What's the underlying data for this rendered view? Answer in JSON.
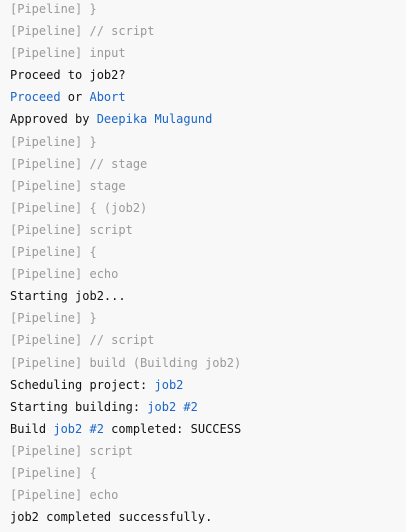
{
  "console": {
    "lines": [
      {
        "kind": "pipeline",
        "text": "[Pipeline] }"
      },
      {
        "kind": "pipeline",
        "text": "[Pipeline] // script"
      },
      {
        "kind": "pipeline",
        "text": "[Pipeline] input"
      },
      {
        "kind": "output",
        "text": "Proceed to job2?"
      },
      {
        "kind": "input-prompt",
        "proceed_link": "Proceed",
        "or_text": " or ",
        "abort_link": "Abort"
      },
      {
        "kind": "approval",
        "prefix": "Approved by ",
        "user_link": "Deepika Mulagund"
      },
      {
        "kind": "pipeline",
        "text": "[Pipeline] }"
      },
      {
        "kind": "pipeline",
        "text": "[Pipeline] // stage"
      },
      {
        "kind": "pipeline",
        "text": "[Pipeline] stage"
      },
      {
        "kind": "pipeline",
        "text": "[Pipeline] { (job2)"
      },
      {
        "kind": "pipeline",
        "text": "[Pipeline] script"
      },
      {
        "kind": "pipeline",
        "text": "[Pipeline] {"
      },
      {
        "kind": "pipeline",
        "text": "[Pipeline] echo"
      },
      {
        "kind": "output",
        "text": "Starting job2..."
      },
      {
        "kind": "pipeline",
        "text": "[Pipeline] }"
      },
      {
        "kind": "pipeline",
        "text": "[Pipeline] // script"
      },
      {
        "kind": "pipeline",
        "text": "[Pipeline] build (Building job2)"
      },
      {
        "kind": "scheduling",
        "prefix": "Scheduling project: ",
        "project_link": "job2"
      },
      {
        "kind": "starting-build",
        "prefix": "Starting building: ",
        "build_link": "job2 #2"
      },
      {
        "kind": "build-result",
        "prefix": "Build ",
        "build_link": "job2 #2",
        "suffix": " completed: SUCCESS"
      },
      {
        "kind": "pipeline",
        "text": "[Pipeline] script"
      },
      {
        "kind": "pipeline",
        "text": "[Pipeline] {"
      },
      {
        "kind": "pipeline",
        "text": "[Pipeline] echo"
      },
      {
        "kind": "output",
        "text": "job2 completed successfully."
      }
    ]
  },
  "colors": {
    "background": "#f8f8f8",
    "pipeline_text": "#9a9a9a",
    "output_text": "#111111",
    "link": "#1a66c9"
  }
}
